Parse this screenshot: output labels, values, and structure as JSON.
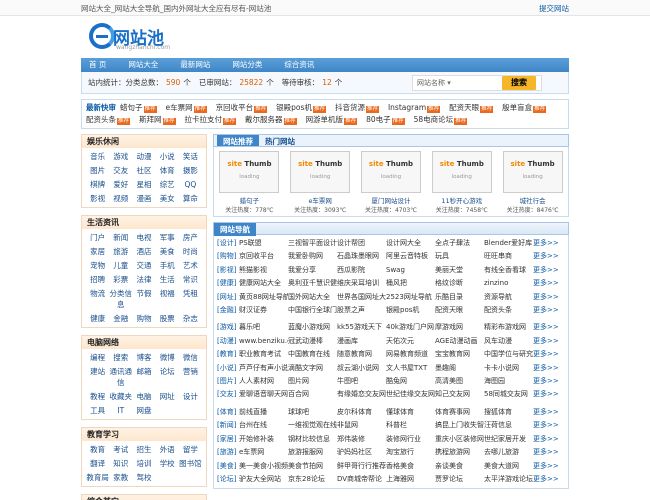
{
  "topbar": {
    "title": "网站大全_网站大全导航_国内外网址大全应有尽有-网站池",
    "submit": "提交网站"
  },
  "logo": {
    "name": "网站池",
    "sub": "wangzhanchi.com"
  },
  "nav": [
    "首 页",
    "网站大全",
    "最新网站",
    "网站分类",
    "综合资讯"
  ],
  "stats": {
    "prefix": "站内统计：分类总数：",
    "cat_count": "590",
    "cat_unit": "个",
    "site_label": "已审网站：",
    "site_count": "25822",
    "site_unit": "个",
    "wait_label": "等待审核：",
    "wait_count": "12",
    "wait_unit": "个"
  },
  "search": {
    "placeholder": "网站名称",
    "button": "搜索"
  },
  "hot": {
    "label": "最新快审",
    "items": [
      [
        "蜡句子",
        "推荐"
      ],
      [
        "e车票网",
        "推荐"
      ],
      [
        "京回收平台",
        "推荐"
      ],
      [
        "银殿pos机",
        "推荐"
      ],
      [
        "抖音货源",
        "推荐"
      ],
      [
        "Instagram",
        "推荐"
      ],
      [
        "配资天眼",
        "推荐"
      ],
      [
        "殷单盲盒",
        "推荐"
      ],
      [
        "配资头条",
        "推荐"
      ],
      [
        "斯拜网",
        "推荐"
      ],
      [
        "拉卡拉支付",
        "推荐"
      ],
      [
        "戴尔服务器",
        "推荐"
      ],
      [
        "网游单机版",
        "推荐"
      ],
      [
        "80电子",
        "推荐"
      ],
      [
        "58电商论坛",
        "推荐"
      ]
    ]
  },
  "left": [
    {
      "title": "娱乐休闲",
      "items": [
        "音乐",
        "游戏",
        "动漫",
        "小说",
        "笑话",
        "图片",
        "交友",
        "社区",
        "体育",
        "摄影",
        "棋牌",
        "爱好",
        "星相",
        "综艺",
        "QQ",
        "影视",
        "视频",
        "漫画",
        "美女",
        "算命"
      ]
    },
    {
      "title": "生活资讯",
      "items": [
        "门户",
        "新闻",
        "电视",
        "军事",
        "房产",
        "家居",
        "旅游",
        "酒店",
        "美食",
        "时尚",
        "宠物",
        "儿童",
        "交通",
        "手机",
        "艺术",
        "招聘",
        "彩票",
        "法律",
        "生活",
        "常识",
        "物流",
        "分类信息",
        "节假",
        "视福",
        "凭租",
        "健康",
        "金融",
        "购物",
        "股票",
        "杂志"
      ]
    },
    {
      "title": "电脑网络",
      "items": [
        "编程",
        "搜索",
        "博客",
        "微博",
        "微信",
        "建站",
        "通讯通信",
        "邮箱",
        "论坛",
        "营销",
        "教程",
        "收藏夹",
        "电脑",
        "网址",
        "设计",
        "工具",
        "IT",
        "网盘"
      ]
    },
    {
      "title": "教育学习",
      "items": [
        "教育",
        "考试",
        "招生",
        "外语",
        "留学",
        "翻译",
        "知识",
        "培训",
        "学校",
        "图书馆",
        "教育局",
        "家教",
        "驾校"
      ]
    },
    {
      "title": "综合其它",
      "items": []
    }
  ],
  "tabs": [
    "网站推荐",
    "热门网站"
  ],
  "thumbs": [
    {
      "name": "蜡句子",
      "hot": "关注热度：778℃"
    },
    {
      "name": "e车票网",
      "hot": "关注热度：3093℃"
    },
    {
      "name": "厦门网站设计",
      "hot": "关注热度：4703℃"
    },
    {
      "name": "11秒开心游戏",
      "hot": "关注热度：7458℃"
    },
    {
      "name": "城社行会",
      "hot": "关注热度：8476℃"
    }
  ],
  "thumb_text": {
    "a": "site",
    "b": "Thumb",
    "c": "loading"
  },
  "dir_title": "网站导航",
  "more": "更多>>",
  "dir": [
    [
      "[设计]",
      "PS联盟",
      "三视智平面设计",
      "设计帮团",
      "设计网大全",
      "全点子肆法",
      "Blender爱好库"
    ],
    [
      "[购物]",
      "京回收平台",
      "我爱卧购网",
      "石晶珠墨眼网",
      "阿里云音特板",
      "玩具",
      "旺旺串商"
    ],
    [
      "[影视]",
      "熊猫影视",
      "我爱分享",
      "西瓜影院",
      "Swag",
      "美丽天堂",
      "有线全香看球"
    ],
    [
      "[健康]",
      "健康网站大全",
      "奥利亚千慧识健",
      "维庆采耳培训",
      "桶风把",
      "格纹诊断",
      "zinzino"
    ],
    [
      "[网址]",
      "黄页88网址导航",
      "国外网站大全",
      "世界各国网址大",
      "2523网址导航",
      "乐酷目录",
      "资源导航"
    ],
    [
      "[金融]",
      "财汉证券",
      "中国银行全球门",
      "股票之声",
      "银殿pos机",
      "配资天眼",
      "配资头条"
    ],
    [
      "gap"
    ],
    [
      "[游戏]",
      "暮乐吧",
      "蓝魔小游戏网",
      "kk55游戏天下",
      "40k游戏门户网",
      "摩游戏网",
      "精彩布游戏网"
    ],
    [
      "[动漫]",
      "www.benziku.c",
      "冠武动漫棒",
      "漫画库",
      "天佑次元",
      "AGE动漫动画",
      "风车动漫"
    ],
    [
      "[教育]",
      "职业教育考试",
      "中国教育在线",
      "随意教育网",
      "网易教育频道",
      "宝宝教育网",
      "中国学位与研究"
    ],
    [
      "[小说]",
      "芦芦仔有声小说",
      "滴酷文字网",
      "叔云湖小说网",
      "文人书屋TXT",
      "墨趣阁",
      "卡卡小说网"
    ],
    [
      "[图片]",
      "人人素材网",
      "图片网",
      "牛图吧",
      "酷兔网",
      "高清美图",
      "海图园"
    ],
    [
      "[交友]",
      "爱聊语音聊天网",
      "百合网",
      "有缘婚恋交友网",
      "世纪佳缘交友网",
      "知己交友网",
      "58同城交友网"
    ],
    [
      "gap"
    ],
    [
      "[体育]",
      "前线直播",
      "球球吧",
      "皮尔科体育",
      "懂球体育",
      "体育赛事网",
      "搜狐体育"
    ],
    [
      "[新闻]",
      "台州在线",
      "一维视觉观在线",
      "非鼠网",
      "科普栏",
      "搞昆上门收失智",
      "汪荷信息"
    ],
    [
      "[家居]",
      "开始修补装",
      "钢材比较信息",
      "郑伟装修",
      "装修网行业",
      "重庆小区装修网",
      "世纪家居开发"
    ],
    [
      "[旅游]",
      "e车票网",
      "旅游报服网",
      "驴妈妈社区",
      "淘宝旅行",
      "携程旅游网",
      "去哪儿旅游"
    ],
    [
      "[美食]",
      "美一美食小视频",
      "美食节拍网",
      "鲜甲哥行行推荐",
      "香格美食",
      "亲谈美食",
      "美食大道网"
    ],
    [
      "[论坛]",
      "驴友大全网站",
      "京东28论坛",
      "DV商城帝帮论",
      "上海雅网",
      "贾罗论坛",
      "太平洋游戏论坛"
    ]
  ]
}
